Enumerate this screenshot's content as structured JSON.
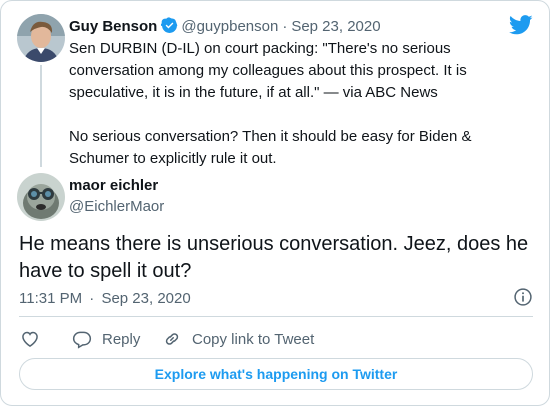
{
  "quoted_tweet": {
    "author_name": "Guy Benson",
    "handle": "@guypbenson",
    "separator": "·",
    "date": "Sep 23, 2020",
    "text_lines": [
      "Sen DURBIN (D-IL) on court packing: \"There's no serious",
      "conversation among my colleagues about this prospect. It is",
      "speculative, it is in the future, if at all.\" — via ABC News"
    ],
    "text_lines_2": [
      "No serious conversation? Then it should be easy for Biden &",
      "Schumer to explicitly rule it out."
    ]
  },
  "reply_tweet": {
    "author_name": "maor eichler",
    "handle": "@EichlerMaor",
    "text_lines": [
      "He means there is unserious conversation. Jeez, does he",
      "have to spell it out?"
    ],
    "time": "11:31 PM",
    "separator": "·",
    "date": "Sep 23, 2020"
  },
  "actions": {
    "reply_label": "Reply",
    "copy_link_label": "Copy link to Tweet"
  },
  "footer": {
    "explore_label": "Explore what's happening on Twitter"
  },
  "colors": {
    "twitter_blue": "#1d9bf0",
    "muted_text": "#536471",
    "border": "#cfd9de"
  },
  "icons": [
    "verified-badge-icon",
    "twitter-logo-icon",
    "info-icon",
    "heart-icon",
    "reply-icon",
    "link-icon"
  ]
}
